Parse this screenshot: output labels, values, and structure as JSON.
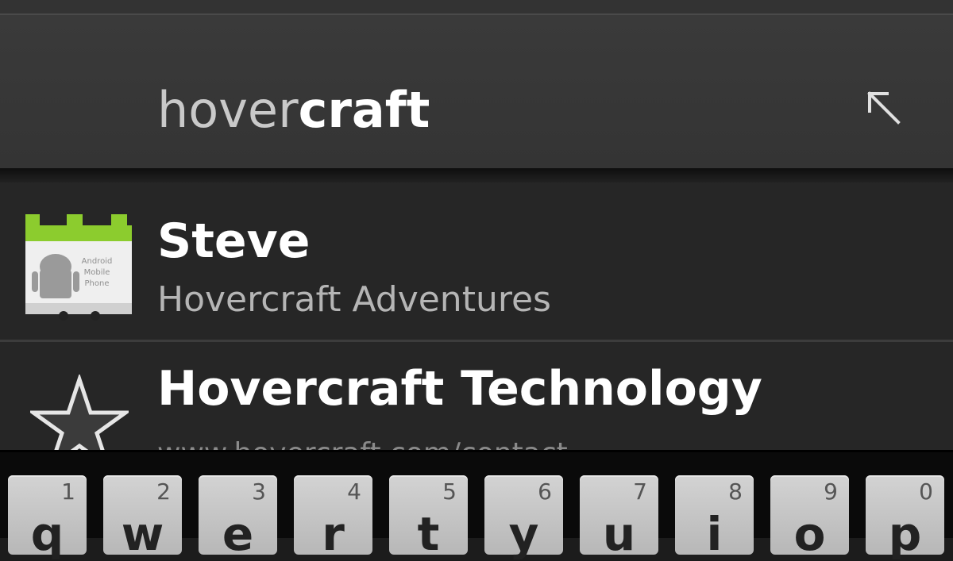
{
  "search": {
    "typed": "hover",
    "completion": "craft"
  },
  "results": [
    {
      "title": "Steve",
      "subtitle": "Hovercraft Adventures",
      "icon": "android-contact-card-icon"
    },
    {
      "title": "Hovercraft Technology",
      "subtitle": "www.hovercraft.com/contact",
      "icon": "star-icon"
    }
  ],
  "contact_card_text": [
    "Android",
    "Mobile",
    "Phone"
  ],
  "keyboard": {
    "keys": [
      {
        "num": "1",
        "letter": "q"
      },
      {
        "num": "2",
        "letter": "w"
      },
      {
        "num": "3",
        "letter": "e"
      },
      {
        "num": "4",
        "letter": "r"
      },
      {
        "num": "5",
        "letter": "t"
      },
      {
        "num": "6",
        "letter": "y"
      },
      {
        "num": "7",
        "letter": "u"
      },
      {
        "num": "8",
        "letter": "i"
      },
      {
        "num": "9",
        "letter": "o"
      },
      {
        "num": "0",
        "letter": "p"
      }
    ]
  },
  "colors": {
    "background": "#1c1c1c",
    "search_bar": "#383838",
    "results_bg": "#262626",
    "key_face": "#c6c6c6"
  }
}
